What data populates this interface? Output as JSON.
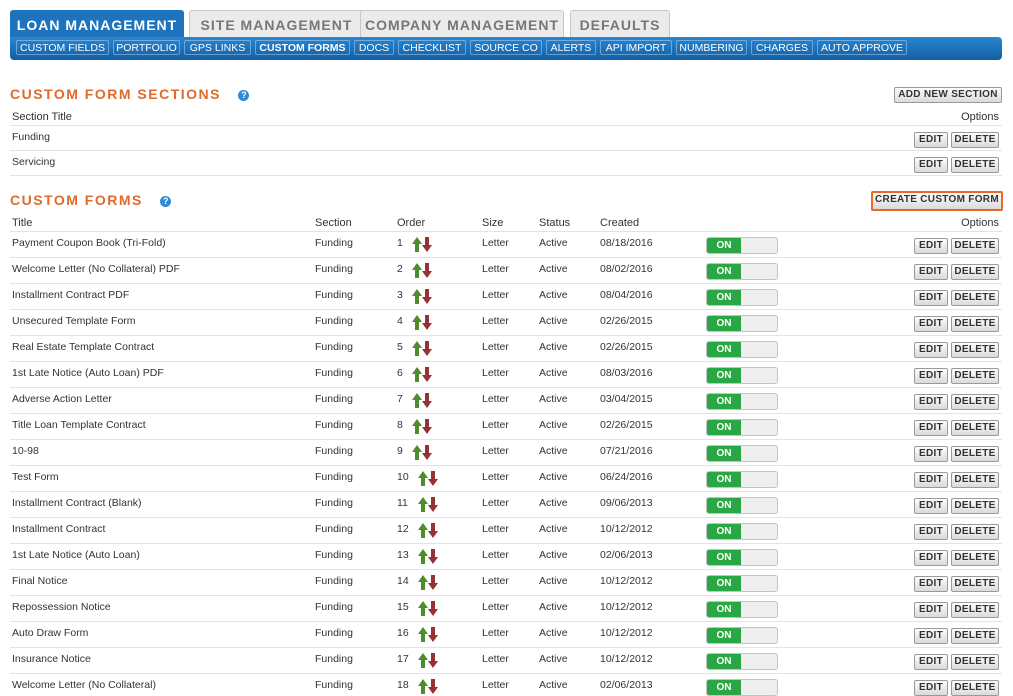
{
  "top_tabs": [
    {
      "label": "LOAN MANAGEMENT",
      "active": true
    },
    {
      "label": "SITE MANAGEMENT",
      "active": false
    },
    {
      "label": "COMPANY MANAGEMENT",
      "active": false
    },
    {
      "label": "DEFAULTS",
      "active": false
    }
  ],
  "sub_nav": [
    {
      "label": "CUSTOM FIELDS"
    },
    {
      "label": "PORTFOLIO"
    },
    {
      "label": "GPS LINKS"
    },
    {
      "label": "CUSTOM FORMS",
      "active": true
    },
    {
      "label": "DOCS"
    },
    {
      "label": "CHECKLIST"
    },
    {
      "label": "SOURCE CO"
    },
    {
      "label": "ALERTS"
    },
    {
      "label": "API IMPORT"
    },
    {
      "label": "NUMBERING"
    },
    {
      "label": "CHARGES"
    },
    {
      "label": "AUTO APPROVE"
    }
  ],
  "sections_panel": {
    "title": "CUSTOM FORM SECTIONS",
    "help_glyph": "?",
    "add_button": "ADD NEW SECTION",
    "columns": {
      "title": "Section Title",
      "options": "Options"
    },
    "rows": [
      {
        "title": "Funding"
      },
      {
        "title": "Servicing"
      }
    ]
  },
  "forms_panel": {
    "title": "CUSTOM FORMS",
    "help_glyph": "?",
    "create_button": "CREATE CUSTOM FORM",
    "columns": {
      "title": "Title",
      "section": "Section",
      "order": "Order",
      "size": "Size",
      "status": "Status",
      "created": "Created",
      "options": "Options"
    },
    "rows": [
      {
        "title": "Payment Coupon Book (Tri-Fold)",
        "section": "Funding",
        "order": "1",
        "size": "Letter",
        "status": "Active",
        "created": "08/18/2016",
        "toggle": "ON"
      },
      {
        "title": "Welcome Letter (No Collateral) PDF",
        "section": "Funding",
        "order": "2",
        "size": "Letter",
        "status": "Active",
        "created": "08/02/2016",
        "toggle": "ON"
      },
      {
        "title": "Installment Contract PDF",
        "section": "Funding",
        "order": "3",
        "size": "Letter",
        "status": "Active",
        "created": "08/04/2016",
        "toggle": "ON"
      },
      {
        "title": "Unsecured Template Form",
        "section": "Funding",
        "order": "4",
        "size": "Letter",
        "status": "Active",
        "created": "02/26/2015",
        "toggle": "ON"
      },
      {
        "title": "Real Estate Template Contract",
        "section": "Funding",
        "order": "5",
        "size": "Letter",
        "status": "Active",
        "created": "02/26/2015",
        "toggle": "ON"
      },
      {
        "title": "1st Late Notice (Auto Loan) PDF",
        "section": "Funding",
        "order": "6",
        "size": "Letter",
        "status": "Active",
        "created": "08/03/2016",
        "toggle": "ON"
      },
      {
        "title": "Adverse Action Letter",
        "section": "Funding",
        "order": "7",
        "size": "Letter",
        "status": "Active",
        "created": "03/04/2015",
        "toggle": "ON"
      },
      {
        "title": "Title Loan Template Contract",
        "section": "Funding",
        "order": "8",
        "size": "Letter",
        "status": "Active",
        "created": "02/26/2015",
        "toggle": "ON"
      },
      {
        "title": "10-98",
        "section": "Funding",
        "order": "9",
        "size": "Letter",
        "status": "Active",
        "created": "07/21/2016",
        "toggle": "ON"
      },
      {
        "title": "Test Form",
        "section": "Funding",
        "order": "10",
        "size": "Letter",
        "status": "Active",
        "created": "06/24/2016",
        "toggle": "ON"
      },
      {
        "title": "Installment Contract (Blank)",
        "section": "Funding",
        "order": "11",
        "size": "Letter",
        "status": "Active",
        "created": "09/06/2013",
        "toggle": "ON"
      },
      {
        "title": "Installment Contract",
        "section": "Funding",
        "order": "12",
        "size": "Letter",
        "status": "Active",
        "created": "10/12/2012",
        "toggle": "ON"
      },
      {
        "title": "1st Late Notice (Auto Loan)",
        "section": "Funding",
        "order": "13",
        "size": "Letter",
        "status": "Active",
        "created": "02/06/2013",
        "toggle": "ON"
      },
      {
        "title": "Final Notice",
        "section": "Funding",
        "order": "14",
        "size": "Letter",
        "status": "Active",
        "created": "10/12/2012",
        "toggle": "ON"
      },
      {
        "title": "Repossession Notice",
        "section": "Funding",
        "order": "15",
        "size": "Letter",
        "status": "Active",
        "created": "10/12/2012",
        "toggle": "ON"
      },
      {
        "title": "Auto Draw Form",
        "section": "Funding",
        "order": "16",
        "size": "Letter",
        "status": "Active",
        "created": "10/12/2012",
        "toggle": "ON"
      },
      {
        "title": "Insurance Notice",
        "section": "Funding",
        "order": "17",
        "size": "Letter",
        "status": "Active",
        "created": "10/12/2012",
        "toggle": "ON"
      },
      {
        "title": "Welcome Letter (No Collateral)",
        "section": "Funding",
        "order": "18",
        "size": "Letter",
        "status": "Active",
        "created": "02/06/2013",
        "toggle": "ON"
      }
    ]
  },
  "row_actions": {
    "edit": "EDIT",
    "delete": "DELETE"
  }
}
